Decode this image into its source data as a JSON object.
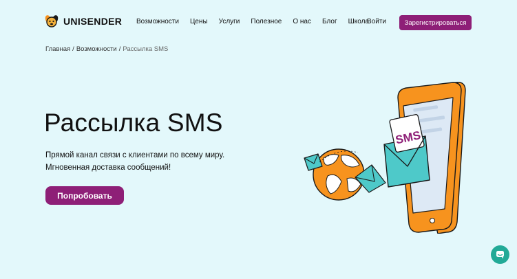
{
  "header": {
    "logo_text": "UNISENDER",
    "nav": [
      "Возможности",
      "Цены",
      "Услуги",
      "Полезное",
      "О нас",
      "Блог",
      "Школа"
    ],
    "login_label": "Войти",
    "register_label": "Зарегистрироваться"
  },
  "breadcrumb": {
    "items": [
      "Главная",
      "Возможности",
      "Рассылка SMS"
    ],
    "separator": "/"
  },
  "hero": {
    "title": "Рассылка SMS",
    "subtitle_line1": "Прямой канал связи с клиентами по всему миру.",
    "subtitle_line2": "Мгновенная доставка сообщений!",
    "cta_label": "Попробовать",
    "illustration_text": "SMS"
  },
  "colors": {
    "background": "#e3f8fb",
    "brand": "#8e1f77",
    "orange": "#f7931e",
    "teal": "#4ec9c9",
    "chat": "#22aa97"
  },
  "icons": {
    "logo": "unisender-dog-icon",
    "chat": "chat-icon"
  }
}
